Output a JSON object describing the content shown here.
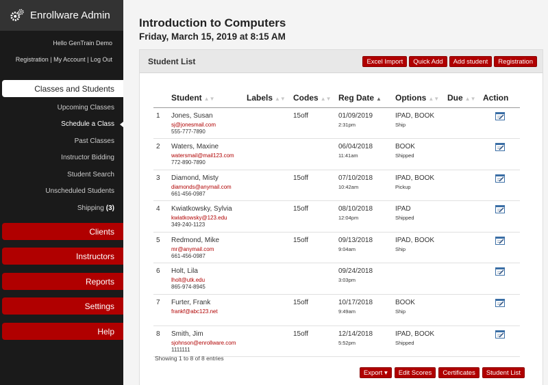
{
  "app": {
    "title": "Enrollware Admin"
  },
  "user": {
    "greeting": "Hello GenTrain Demo",
    "links": [
      "Registration",
      "My Account",
      "Log Out"
    ]
  },
  "nav": {
    "active": "Classes and Students",
    "subitems": [
      "Upcoming Classes",
      "Schedule a Class",
      "Past Classes",
      "Instructor Bidding",
      "Student Search",
      "Unscheduled Students",
      "Shipping"
    ],
    "shipping_count": "(3)",
    "sections": [
      "Clients",
      "Instructors",
      "Reports",
      "Settings",
      "Help"
    ]
  },
  "page": {
    "title": "Introduction to Computers",
    "subtitle": "Friday, March 15, 2019 at 8:15 AM"
  },
  "panel": {
    "title": "Student List",
    "header_buttons": [
      "Excel Import",
      "Quick Add",
      "Add student",
      "Registration"
    ],
    "footer_buttons": [
      "Export ▾",
      "Edit Scores",
      "Certificates",
      "Student List"
    ]
  },
  "table": {
    "columns": [
      "Student",
      "Labels",
      "Codes",
      "Reg Date",
      "Options",
      "Due",
      "Action"
    ],
    "rows": [
      {
        "n": "1",
        "name": "Jones, Susan",
        "email": "sj@jonesmail.com",
        "phone": "555-777-7890",
        "codes": "15off",
        "date": "01/09/2019",
        "time": "2:31pm",
        "options": "IPAD, BOOK",
        "status": "Ship"
      },
      {
        "n": "2",
        "name": "Waters, Maxine",
        "email": "watersmail@mail123.com",
        "phone": "772-890-7890",
        "codes": "",
        "date": "06/04/2018",
        "time": "11:41am",
        "options": "BOOK",
        "status": "Shipped"
      },
      {
        "n": "3",
        "name": "Diamond, Misty",
        "email": "diamonds@anymail.com",
        "phone": "661-456-0987",
        "codes": "15off",
        "date": "07/10/2018",
        "time": "10:42am",
        "options": "IPAD, BOOK",
        "status": "Pickup"
      },
      {
        "n": "4",
        "name": "Kwiatkowsky, Sylvia",
        "email": "kwiatkowsky@123.edu",
        "phone": "349-240-1123",
        "codes": "15off",
        "date": "08/10/2018",
        "time": "12:04pm",
        "options": "IPAD",
        "status": "Shipped"
      },
      {
        "n": "5",
        "name": "Redmond, Mike",
        "email": "mr@anymail.com",
        "phone": "661-456-0987",
        "codes": "15off",
        "date": "09/13/2018",
        "time": "9:04am",
        "options": "IPAD, BOOK",
        "status": "Ship"
      },
      {
        "n": "6",
        "name": "Holt, Lila",
        "email": "lholt@utk.edu",
        "phone": "865-974-8945",
        "codes": "",
        "date": "09/24/2018",
        "time": "3:03pm",
        "options": "",
        "status": ""
      },
      {
        "n": "7",
        "name": "Furter, Frank",
        "email": "frankf@abc123.net",
        "phone": "",
        "codes": "15off",
        "date": "10/17/2018",
        "time": "9:49am",
        "options": "BOOK",
        "status": "Ship"
      },
      {
        "n": "8",
        "name": "Smith, Jim",
        "email": "sjohnson@enrollware.com",
        "phone": "1111111",
        "codes": "15off",
        "date": "12/14/2018",
        "time": "5:52pm",
        "options": "IPAD, BOOK",
        "status": "Shipped"
      }
    ]
  },
  "footer": {
    "showing": "Showing 1 to 8 of 8 entries"
  },
  "colors": {
    "accent": "#b00000",
    "sidebar": "#1a1a1a"
  },
  "icons": {
    "brand": "gears-icon",
    "action": "edit-icon",
    "sort": "sort-arrows-icon"
  }
}
